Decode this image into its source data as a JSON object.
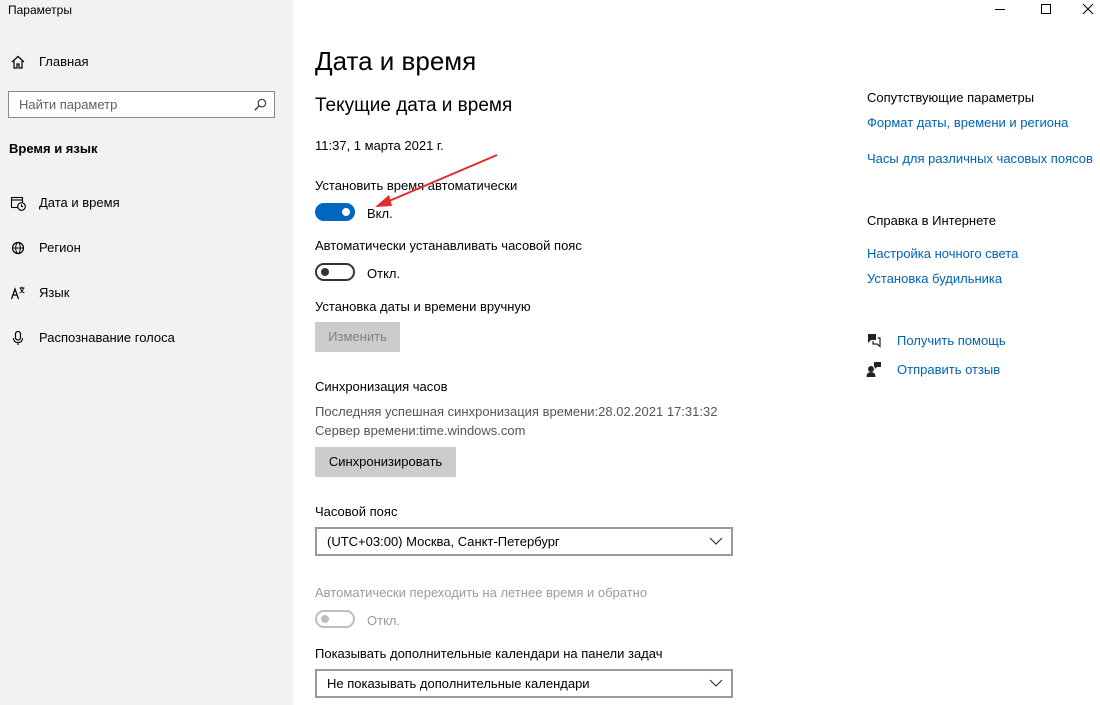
{
  "window": {
    "title": "Параметры"
  },
  "sidebar": {
    "home_label": "Главная",
    "search_placeholder": "Найти параметр",
    "section_title": "Время и язык",
    "items": [
      {
        "label": "Дата и время",
        "icon": "calendar-clock-icon"
      },
      {
        "label": "Регион",
        "icon": "globe-icon"
      },
      {
        "label": "Язык",
        "icon": "language-icon"
      },
      {
        "label": "Распознавание голоса",
        "icon": "microphone-icon"
      }
    ]
  },
  "main": {
    "title": "Дата и время",
    "subtitle": "Текущие дата и время",
    "current_datetime": "11:37, 1 марта 2021 г.",
    "auto_time": {
      "label": "Установить время автоматически",
      "state": "Вкл.",
      "on": true
    },
    "auto_timezone": {
      "label": "Автоматически устанавливать часовой пояс",
      "state": "Откл.",
      "on": false
    },
    "manual": {
      "label": "Установка даты и времени вручную",
      "button": "Изменить"
    },
    "sync": {
      "heading": "Синхронизация часов",
      "last_sync": "Последняя успешная синхронизация времени:28.02.2021 17:31:32",
      "server": "Сервер времени:time.windows.com",
      "button": "Синхронизировать"
    },
    "timezone": {
      "label": "Часовой пояс",
      "value": "(UTC+03:00) Москва, Санкт-Петербург"
    },
    "dst": {
      "label": "Автоматически переходить на летнее время и обратно",
      "state": "Откл.",
      "on": false,
      "disabled": true
    },
    "calendars": {
      "label": "Показывать дополнительные календари на панели задач",
      "value": "Не показывать дополнительные календари"
    }
  },
  "related": {
    "heading": "Сопутствующие параметры",
    "links": [
      "Формат даты, времени и региона",
      "Часы для различных часовых поясов"
    ],
    "web_heading": "Справка в Интернете",
    "web_links": [
      "Настройка ночного света",
      "Установка будильника"
    ],
    "help": "Получить помощь",
    "feedback": "Отправить отзыв"
  },
  "colors": {
    "accent": "#0067c0",
    "link": "#0063b1",
    "sidebar_bg": "#f2f2f2",
    "annotation_arrow": "#e8282b"
  }
}
